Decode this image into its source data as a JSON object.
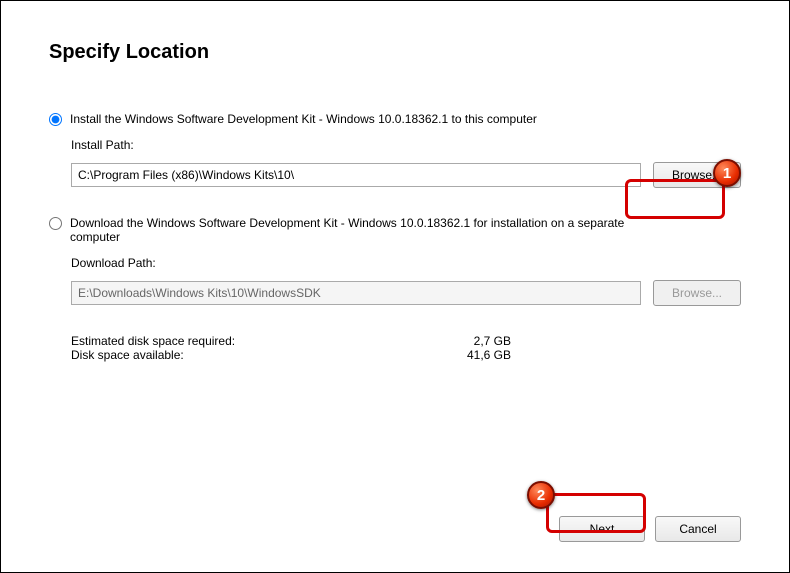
{
  "title": "Specify Location",
  "option1": {
    "label": "Install the Windows Software Development Kit - Windows 10.0.18362.1 to this computer",
    "path_label": "Install Path:",
    "path_value": "C:\\Program Files (x86)\\Windows Kits\\10\\",
    "browse": "Browse..."
  },
  "option2": {
    "label": "Download the Windows Software Development Kit - Windows 10.0.18362.1 for installation on a separate computer",
    "path_label": "Download Path:",
    "path_value": "E:\\Downloads\\Windows Kits\\10\\WindowsSDK",
    "browse": "Browse..."
  },
  "disk": {
    "required_label": "Estimated disk space required:",
    "required_value": "2,7 GB",
    "available_label": "Disk space available:",
    "available_value": "41,6 GB"
  },
  "footer": {
    "next": "Next",
    "cancel": "Cancel"
  },
  "markers": {
    "m1": "1",
    "m2": "2"
  }
}
